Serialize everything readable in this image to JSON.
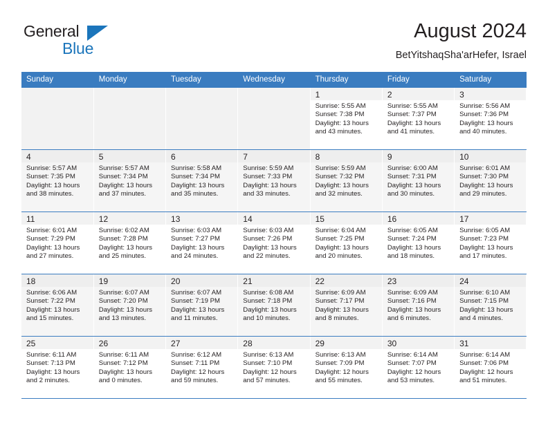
{
  "brand": {
    "name_top": "General",
    "name_bottom": "Blue",
    "triangle_color": "#1b75bb"
  },
  "header": {
    "title": "August 2024",
    "location": "BetYitshaqSha'arHefer, Israel"
  },
  "colors": {
    "header_blue": "#3a7cc0",
    "row_divider": "#3a7cc0",
    "daynum_strip": "#f2f2f2",
    "alt_row": "#f5f5f5",
    "text": "#231f20"
  },
  "weekdays": [
    "Sunday",
    "Monday",
    "Tuesday",
    "Wednesday",
    "Thursday",
    "Friday",
    "Saturday"
  ],
  "labels": {
    "sunrise_prefix": "Sunrise:",
    "sunset_prefix": "Sunset:",
    "daylight_prefix": "Daylight:"
  },
  "weeks": [
    [
      {
        "day": "",
        "blank": true
      },
      {
        "day": "",
        "blank": true
      },
      {
        "day": "",
        "blank": true
      },
      {
        "day": "",
        "blank": true
      },
      {
        "day": "1",
        "sunrise": "Sunrise: 5:55 AM",
        "sunset": "Sunset: 7:38 PM",
        "daylight": "Daylight: 13 hours and 43 minutes."
      },
      {
        "day": "2",
        "sunrise": "Sunrise: 5:55 AM",
        "sunset": "Sunset: 7:37 PM",
        "daylight": "Daylight: 13 hours and 41 minutes."
      },
      {
        "day": "3",
        "sunrise": "Sunrise: 5:56 AM",
        "sunset": "Sunset: 7:36 PM",
        "daylight": "Daylight: 13 hours and 40 minutes."
      }
    ],
    [
      {
        "day": "4",
        "sunrise": "Sunrise: 5:57 AM",
        "sunset": "Sunset: 7:35 PM",
        "daylight": "Daylight: 13 hours and 38 minutes."
      },
      {
        "day": "5",
        "sunrise": "Sunrise: 5:57 AM",
        "sunset": "Sunset: 7:34 PM",
        "daylight": "Daylight: 13 hours and 37 minutes."
      },
      {
        "day": "6",
        "sunrise": "Sunrise: 5:58 AM",
        "sunset": "Sunset: 7:34 PM",
        "daylight": "Daylight: 13 hours and 35 minutes."
      },
      {
        "day": "7",
        "sunrise": "Sunrise: 5:59 AM",
        "sunset": "Sunset: 7:33 PM",
        "daylight": "Daylight: 13 hours and 33 minutes."
      },
      {
        "day": "8",
        "sunrise": "Sunrise: 5:59 AM",
        "sunset": "Sunset: 7:32 PM",
        "daylight": "Daylight: 13 hours and 32 minutes."
      },
      {
        "day": "9",
        "sunrise": "Sunrise: 6:00 AM",
        "sunset": "Sunset: 7:31 PM",
        "daylight": "Daylight: 13 hours and 30 minutes."
      },
      {
        "day": "10",
        "sunrise": "Sunrise: 6:01 AM",
        "sunset": "Sunset: 7:30 PM",
        "daylight": "Daylight: 13 hours and 29 minutes."
      }
    ],
    [
      {
        "day": "11",
        "sunrise": "Sunrise: 6:01 AM",
        "sunset": "Sunset: 7:29 PM",
        "daylight": "Daylight: 13 hours and 27 minutes."
      },
      {
        "day": "12",
        "sunrise": "Sunrise: 6:02 AM",
        "sunset": "Sunset: 7:28 PM",
        "daylight": "Daylight: 13 hours and 25 minutes."
      },
      {
        "day": "13",
        "sunrise": "Sunrise: 6:03 AM",
        "sunset": "Sunset: 7:27 PM",
        "daylight": "Daylight: 13 hours and 24 minutes."
      },
      {
        "day": "14",
        "sunrise": "Sunrise: 6:03 AM",
        "sunset": "Sunset: 7:26 PM",
        "daylight": "Daylight: 13 hours and 22 minutes."
      },
      {
        "day": "15",
        "sunrise": "Sunrise: 6:04 AM",
        "sunset": "Sunset: 7:25 PM",
        "daylight": "Daylight: 13 hours and 20 minutes."
      },
      {
        "day": "16",
        "sunrise": "Sunrise: 6:05 AM",
        "sunset": "Sunset: 7:24 PM",
        "daylight": "Daylight: 13 hours and 18 minutes."
      },
      {
        "day": "17",
        "sunrise": "Sunrise: 6:05 AM",
        "sunset": "Sunset: 7:23 PM",
        "daylight": "Daylight: 13 hours and 17 minutes."
      }
    ],
    [
      {
        "day": "18",
        "sunrise": "Sunrise: 6:06 AM",
        "sunset": "Sunset: 7:22 PM",
        "daylight": "Daylight: 13 hours and 15 minutes."
      },
      {
        "day": "19",
        "sunrise": "Sunrise: 6:07 AM",
        "sunset": "Sunset: 7:20 PM",
        "daylight": "Daylight: 13 hours and 13 minutes."
      },
      {
        "day": "20",
        "sunrise": "Sunrise: 6:07 AM",
        "sunset": "Sunset: 7:19 PM",
        "daylight": "Daylight: 13 hours and 11 minutes."
      },
      {
        "day": "21",
        "sunrise": "Sunrise: 6:08 AM",
        "sunset": "Sunset: 7:18 PM",
        "daylight": "Daylight: 13 hours and 10 minutes."
      },
      {
        "day": "22",
        "sunrise": "Sunrise: 6:09 AM",
        "sunset": "Sunset: 7:17 PM",
        "daylight": "Daylight: 13 hours and 8 minutes."
      },
      {
        "day": "23",
        "sunrise": "Sunrise: 6:09 AM",
        "sunset": "Sunset: 7:16 PM",
        "daylight": "Daylight: 13 hours and 6 minutes."
      },
      {
        "day": "24",
        "sunrise": "Sunrise: 6:10 AM",
        "sunset": "Sunset: 7:15 PM",
        "daylight": "Daylight: 13 hours and 4 minutes."
      }
    ],
    [
      {
        "day": "25",
        "sunrise": "Sunrise: 6:11 AM",
        "sunset": "Sunset: 7:13 PM",
        "daylight": "Daylight: 13 hours and 2 minutes."
      },
      {
        "day": "26",
        "sunrise": "Sunrise: 6:11 AM",
        "sunset": "Sunset: 7:12 PM",
        "daylight": "Daylight: 13 hours and 0 minutes."
      },
      {
        "day": "27",
        "sunrise": "Sunrise: 6:12 AM",
        "sunset": "Sunset: 7:11 PM",
        "daylight": "Daylight: 12 hours and 59 minutes."
      },
      {
        "day": "28",
        "sunrise": "Sunrise: 6:13 AM",
        "sunset": "Sunset: 7:10 PM",
        "daylight": "Daylight: 12 hours and 57 minutes."
      },
      {
        "day": "29",
        "sunrise": "Sunrise: 6:13 AM",
        "sunset": "Sunset: 7:09 PM",
        "daylight": "Daylight: 12 hours and 55 minutes."
      },
      {
        "day": "30",
        "sunrise": "Sunrise: 6:14 AM",
        "sunset": "Sunset: 7:07 PM",
        "daylight": "Daylight: 12 hours and 53 minutes."
      },
      {
        "day": "31",
        "sunrise": "Sunrise: 6:14 AM",
        "sunset": "Sunset: 7:06 PM",
        "daylight": "Daylight: 12 hours and 51 minutes."
      }
    ]
  ]
}
